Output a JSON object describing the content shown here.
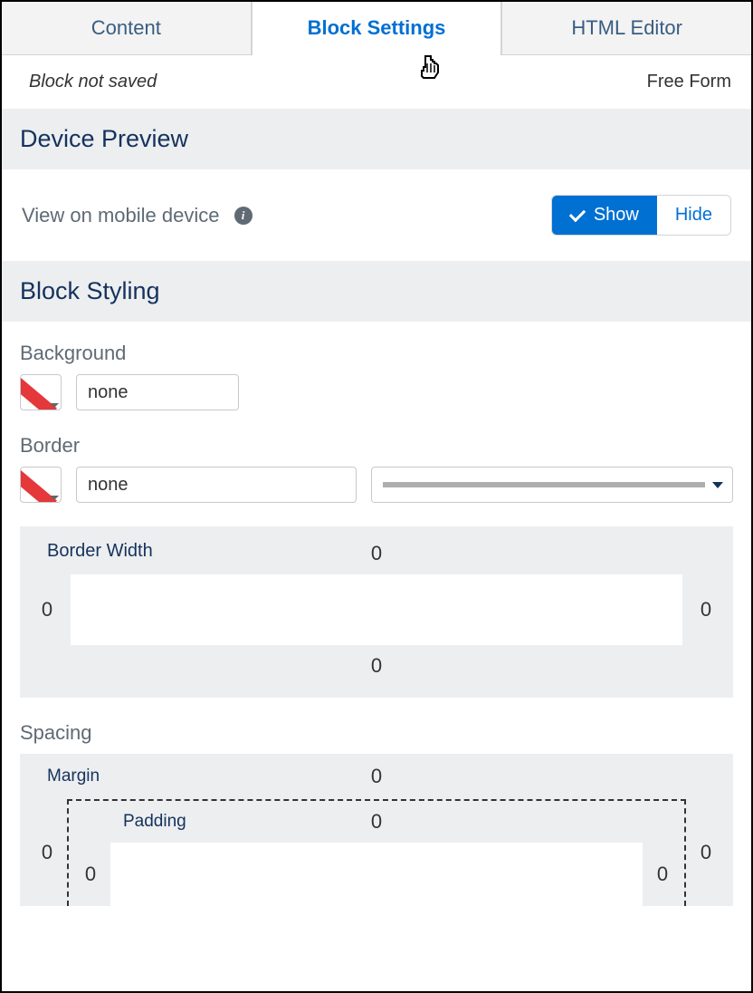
{
  "tabs": {
    "content": "Content",
    "block_settings": "Block Settings",
    "html_editor": "HTML Editor"
  },
  "status": {
    "not_saved": "Block not saved",
    "free_form": "Free Form"
  },
  "device_preview": {
    "title": "Device Preview",
    "label": "View on mobile device",
    "show": "Show",
    "hide": "Hide"
  },
  "block_styling": {
    "title": "Block Styling",
    "background": {
      "label": "Background",
      "value": "none"
    },
    "border": {
      "label": "Border",
      "value": "none"
    },
    "border_width": {
      "label": "Border Width",
      "top": "0",
      "left": "0",
      "right": "0",
      "bottom": "0"
    },
    "spacing": {
      "label": "Spacing",
      "margin": {
        "label": "Margin",
        "top": "0",
        "left": "0",
        "right": "0"
      },
      "padding": {
        "label": "Padding",
        "top": "0",
        "left": "0",
        "right": "0"
      }
    }
  }
}
